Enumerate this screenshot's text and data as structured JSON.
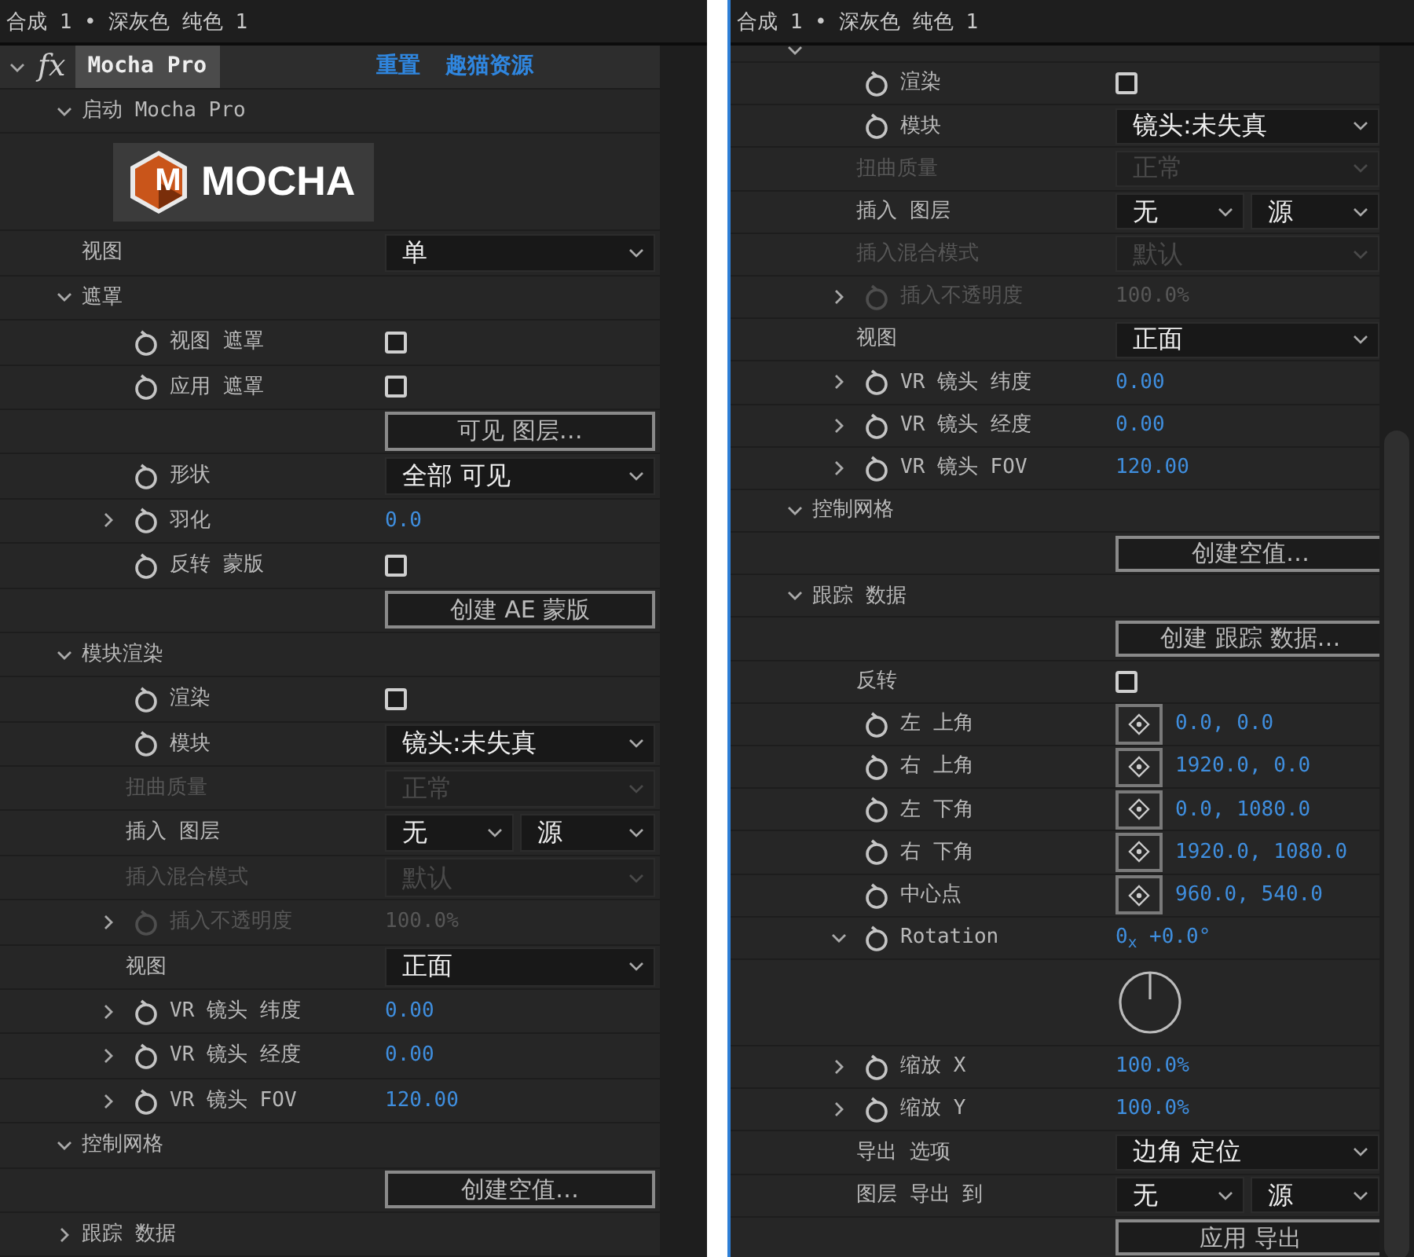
{
  "panels": [
    {
      "title": "合成 1 • 深灰色 纯色 1",
      "effect": {
        "expanded": true,
        "fx": "fx",
        "name": "Mocha Pro",
        "links": [
          "重置",
          "趣猫资源"
        ]
      },
      "rows": [
        {
          "kind": "section",
          "label": "启动 Mocha Pro",
          "expanded": true,
          "children": [
            {
              "kind": "logo",
              "mark": "M",
              "wordmark": "MOCHA"
            }
          ]
        },
        {
          "kind": "dropdown",
          "label": "视图",
          "value": "单"
        },
        {
          "kind": "section",
          "label": "遮罩",
          "expanded": true,
          "children": [
            {
              "kind": "checkbox",
              "label": "视图 遮罩",
              "stopwatch": true,
              "checked": false
            },
            {
              "kind": "checkbox",
              "label": "应用 遮罩",
              "stopwatch": true,
              "checked": false
            },
            {
              "kind": "button",
              "text": "可见 图层…"
            },
            {
              "kind": "dropdown",
              "label": "形状",
              "stopwatch": true,
              "value": "全部 可见"
            },
            {
              "kind": "value",
              "label": "羽化",
              "stopwatch": true,
              "expanded": false,
              "value": "0.0"
            },
            {
              "kind": "checkbox",
              "label": "反转 蒙版",
              "stopwatch": true,
              "checked": false
            },
            {
              "kind": "button",
              "text": "创建 AE 蒙版"
            }
          ]
        },
        {
          "kind": "section",
          "label": "模块渲染",
          "expanded": true,
          "children": [
            {
              "kind": "checkbox",
              "label": "渲染",
              "stopwatch": true,
              "checked": false
            },
            {
              "kind": "dropdown",
              "label": "模块",
              "stopwatch": true,
              "value": "镜头:未失真"
            },
            {
              "kind": "dropdown",
              "label": "扭曲质量",
              "disabled": true,
              "value": "正常"
            },
            {
              "kind": "dropdown_pair",
              "label": "插入 图层",
              "values": [
                "无",
                "源"
              ]
            },
            {
              "kind": "dropdown",
              "label": "插入混合模式",
              "disabled": true,
              "value": "默认"
            },
            {
              "kind": "value",
              "label": "插入不透明度",
              "stopwatch": true,
              "disabled": true,
              "expanded": false,
              "value": "100.0%"
            },
            {
              "kind": "dropdown",
              "label": "视图",
              "value": "正面"
            },
            {
              "kind": "value",
              "label": "VR 镜头 纬度",
              "stopwatch": true,
              "expanded": false,
              "value": "0.00"
            },
            {
              "kind": "value",
              "label": "VR 镜头 经度",
              "stopwatch": true,
              "expanded": false,
              "value": "0.00"
            },
            {
              "kind": "value",
              "label": "VR 镜头 FOV",
              "stopwatch": true,
              "expanded": false,
              "value": "120.00"
            }
          ]
        },
        {
          "kind": "section",
          "label": "控制网格",
          "expanded": true,
          "children": [
            {
              "kind": "button",
              "text": "创建空值…"
            }
          ]
        },
        {
          "kind": "section",
          "label": "跟踪 数据",
          "expanded": false,
          "children": []
        }
      ]
    },
    {
      "title": "合成 1 • 深灰色 纯色 1",
      "rows": [
        {
          "kind": "section",
          "expanded": true,
          "children": [
            {
              "kind": "checkbox",
              "label": "渲染",
              "stopwatch": true,
              "checked": false
            },
            {
              "kind": "dropdown",
              "label": "模块",
              "stopwatch": true,
              "value": "镜头:未失真"
            },
            {
              "kind": "dropdown",
              "label": "扭曲质量",
              "disabled": true,
              "value": "正常"
            },
            {
              "kind": "dropdown_pair",
              "label": "插入 图层",
              "values": [
                "无",
                "源"
              ]
            },
            {
              "kind": "dropdown",
              "label": "插入混合模式",
              "disabled": true,
              "value": "默认"
            },
            {
              "kind": "value",
              "label": "插入不透明度",
              "stopwatch": true,
              "disabled": true,
              "expanded": false,
              "value": "100.0%"
            },
            {
              "kind": "dropdown",
              "label": "视图",
              "value": "正面"
            },
            {
              "kind": "value",
              "label": "VR 镜头 纬度",
              "stopwatch": true,
              "expanded": false,
              "value": "0.00"
            },
            {
              "kind": "value",
              "label": "VR 镜头 经度",
              "stopwatch": true,
              "expanded": false,
              "value": "0.00"
            },
            {
              "kind": "value",
              "label": "VR 镜头 FOV",
              "stopwatch": true,
              "expanded": false,
              "value": "120.00"
            }
          ]
        },
        {
          "kind": "section",
          "label": "控制网格",
          "expanded": true,
          "children": [
            {
              "kind": "button",
              "text": "创建空值…"
            }
          ]
        },
        {
          "kind": "section",
          "label": "跟踪 数据",
          "expanded": true,
          "children": [
            {
              "kind": "button",
              "text": "创建 跟踪 数据…"
            },
            {
              "kind": "checkbox",
              "label": "反转",
              "checked": false
            },
            {
              "kind": "point",
              "label": "左 上角",
              "stopwatch": true,
              "value": "0.0, 0.0"
            },
            {
              "kind": "point",
              "label": "右 上角",
              "stopwatch": true,
              "value": "1920.0, 0.0"
            },
            {
              "kind": "point",
              "label": "左 下角",
              "stopwatch": true,
              "value": "0.0, 1080.0"
            },
            {
              "kind": "point",
              "label": "右 下角",
              "stopwatch": true,
              "value": "1920.0, 1080.0"
            },
            {
              "kind": "point",
              "label": "中心点",
              "stopwatch": true,
              "value": "960.0, 540.0"
            },
            {
              "kind": "value",
              "label": "Rotation",
              "stopwatch": true,
              "expanded": true,
              "value": "0$_{x}$ +0.0°",
              "children": [
                {
                  "kind": "dial"
                }
              ]
            },
            {
              "kind": "value",
              "label": "缩放 X",
              "stopwatch": true,
              "expanded": false,
              "value": "100.0%"
            },
            {
              "kind": "value",
              "label": "缩放 Y",
              "stopwatch": true,
              "expanded": false,
              "value": "100.0%"
            },
            {
              "kind": "dropdown",
              "label": "导出 选项",
              "value": "边角 定位"
            },
            {
              "kind": "dropdown_pair",
              "label": "图层 导出 到",
              "values": [
                "无",
                "源"
              ]
            },
            {
              "kind": "button",
              "text": "应用 导出"
            }
          ]
        }
      ]
    }
  ]
}
